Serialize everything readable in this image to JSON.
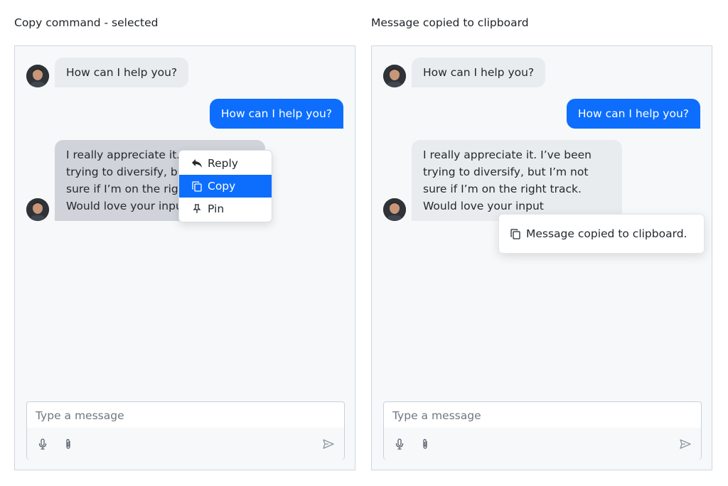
{
  "panels": [
    {
      "title": "Copy command - selected",
      "messages": [
        {
          "text": "How can I help you?"
        },
        {
          "text": "How can I help you?"
        },
        {
          "lines": [
            "I really appreciate it. I’ve been",
            "trying to diversify, but I’m not",
            "sure if I’m on the right track.",
            "Would love your input"
          ]
        }
      ],
      "context_menu": {
        "items": [
          {
            "label": "Reply",
            "icon": "reply-icon"
          },
          {
            "label": "Copy",
            "icon": "copy-icon",
            "active": true
          },
          {
            "label": "Pin",
            "icon": "pin-icon"
          }
        ]
      },
      "composer": {
        "placeholder": "Type a message"
      }
    },
    {
      "title": "Message copied to clipboard",
      "messages": [
        {
          "text": "How can I help you?"
        },
        {
          "text": "How can I help you?"
        },
        {
          "lines": [
            "I really appreciate it. I’ve been",
            "trying to diversify, but I’m not",
            "sure if I’m on the right track.",
            "Would love your input"
          ]
        }
      ],
      "toast": {
        "text": "Message copied to clipboard.",
        "icon": "copy-icon"
      },
      "composer": {
        "placeholder": "Type a message"
      }
    }
  ],
  "colors": {
    "accent": "#0d6efd",
    "panel_bg": "#f6f8fa",
    "incoming_bubble": "#e9ecef",
    "selected_bubble": "#d0d4da"
  }
}
